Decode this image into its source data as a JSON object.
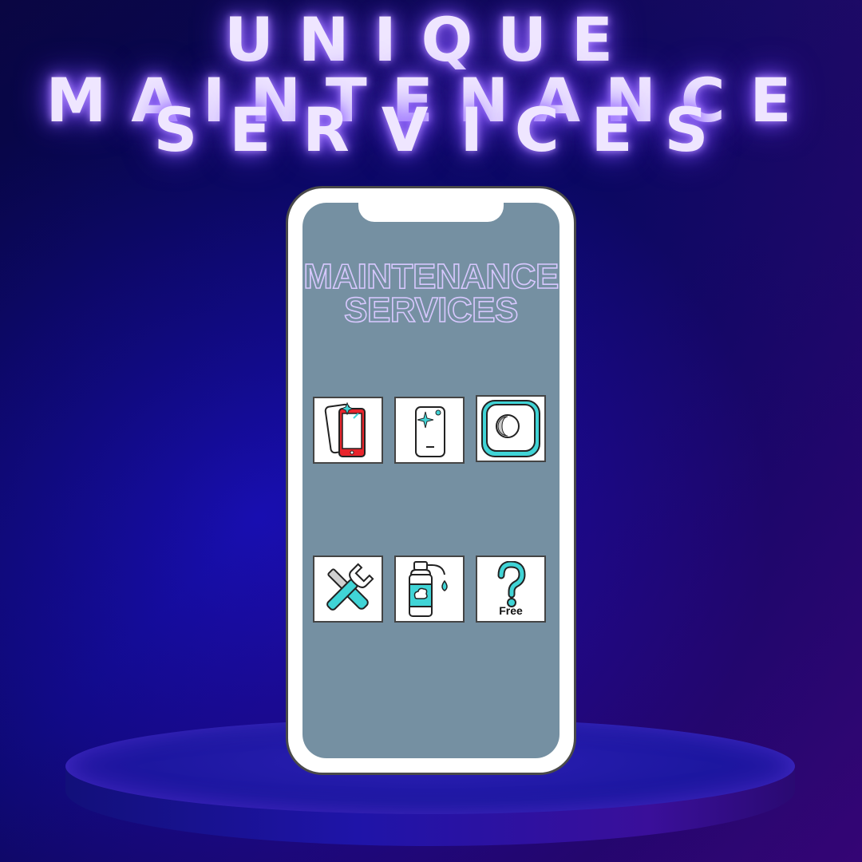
{
  "headline": {
    "line1": "UNIQUE MAINTENANCE",
    "line2": "SERVICES"
  },
  "phone": {
    "title_line1": "MAINTENANCE",
    "title_line2": "SERVICES",
    "services": [
      {
        "icon": "screen-protector-icon"
      },
      {
        "icon": "phone-shine-icon"
      },
      {
        "icon": "button-icon"
      },
      {
        "icon": "tools-icon"
      },
      {
        "icon": "cleaning-spray-icon"
      },
      {
        "icon": "question-mark-icon",
        "label": "Free"
      }
    ]
  },
  "colors": {
    "accent": "#40d4d6",
    "screen": "#7590a2",
    "headline_glow": "#8b5cff"
  }
}
